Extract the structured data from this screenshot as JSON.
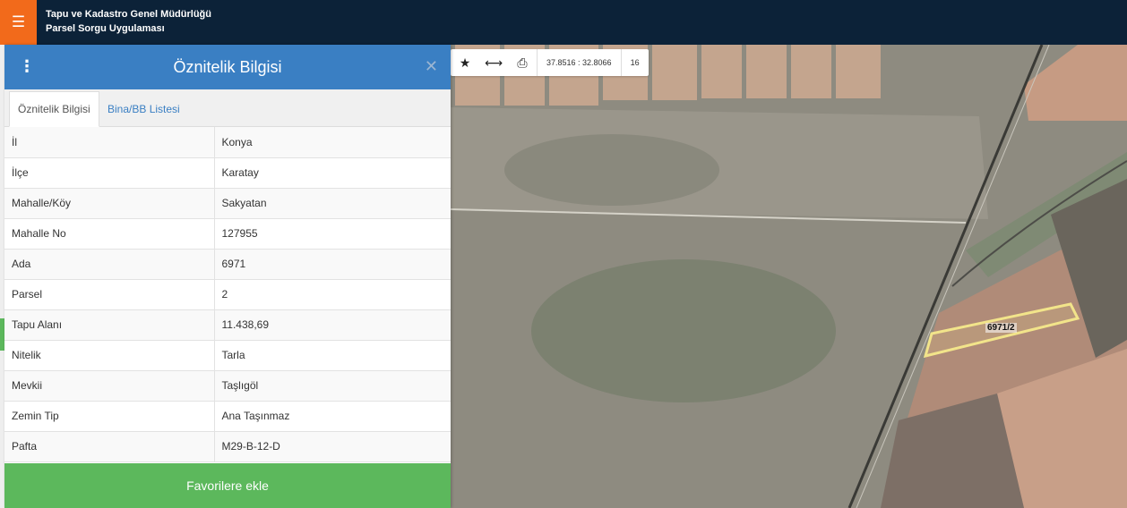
{
  "app": {
    "title_line1": "Tapu ve Kadastro Genel Müdürlüğü",
    "title_line2": "Parsel Sorgu Uygulaması",
    "menu_icon": "hamburger-icon",
    "accent_color": "#f26a1b",
    "topbar_color": "#0c2238"
  },
  "panel": {
    "title": "Öznitelik Bilgisi",
    "header_color": "#3a7fc3",
    "tabs": [
      {
        "label": "Öznitelik Bilgisi",
        "active": true
      },
      {
        "label": "Bina/BB Listesi",
        "active": false
      }
    ],
    "rows": [
      {
        "key": "İl",
        "value": "Konya"
      },
      {
        "key": "İlçe",
        "value": "Karatay"
      },
      {
        "key": "Mahalle/Köy",
        "value": "Sakyatan"
      },
      {
        "key": "Mahalle No",
        "value": "127955"
      },
      {
        "key": "Ada",
        "value": "6971"
      },
      {
        "key": "Parsel",
        "value": "2"
      },
      {
        "key": "Tapu Alanı",
        "value": "11.438,69"
      },
      {
        "key": "Nitelik",
        "value": "Tarla"
      },
      {
        "key": "Mevkii",
        "value": "Taşlıgöl"
      },
      {
        "key": "Zemin Tip",
        "value": "Ana Taşınmaz"
      },
      {
        "key": "Pafta",
        "value": "M29-B-12-D"
      }
    ],
    "favorite_label": "Favorilere ekle",
    "favorite_color": "#5cb85c"
  },
  "map_toolbar": {
    "coordinates": "37.8516 : 32.8066",
    "zoom": "16"
  },
  "map": {
    "parcel_label": "6971/2",
    "parcel_color": "#f2e48a"
  }
}
